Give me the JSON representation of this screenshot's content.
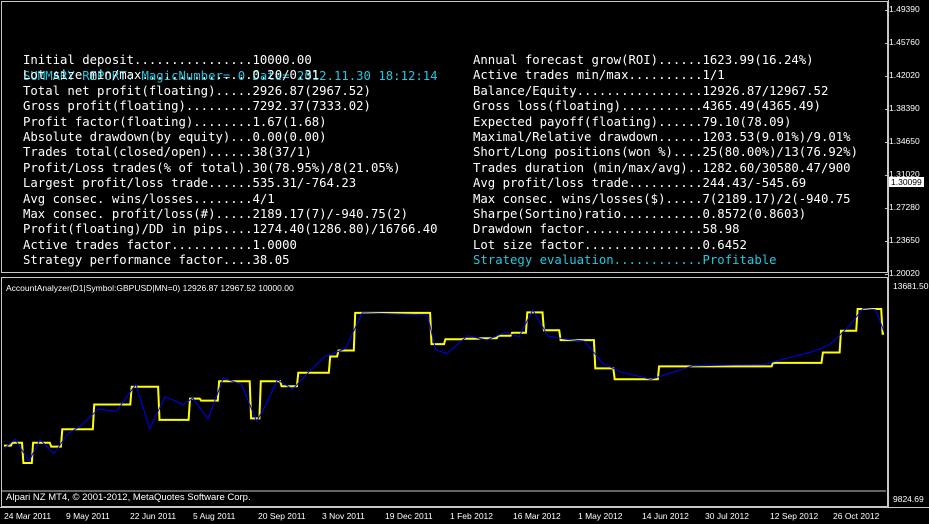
{
  "report": {
    "title": "SUMMARY REPORT: MagicNumber= 0 Date= 2012.11.30 18:12:14",
    "left": [
      "Initial deposit................10000.00",
      "Lot size min/max...............0.20/0.31",
      "Total net profit(floating).....2926.87(2967.52)",
      "Gross profit(floating).........7292.37(7333.02)",
      "Profit factor(floating)........1.67(1.68)",
      "Absolute drawdown(by equity)...0.00(0.00)",
      "Trades total(closed/open)......38(37/1)",
      "Profit/Loss trades(% of total).30(78.95%)/8(21.05%)",
      "Largest profit/loss trade......535.31/-764.23",
      "Avg consec. wins/losses........4/1",
      "Max consec. profit/loss(#).....2189.17(7)/-940.75(2)",
      "Profit(floating)/DD in pips....1274.40(1286.80)/16766.40",
      "Active trades factor...........1.0000",
      "Strategy performance factor....38.05"
    ],
    "right": [
      "Annual forecast grow(ROI)......1623.99(16.24%)",
      "Active trades min/max..........1/1",
      "Balance/Equity.................12926.87/12967.52",
      "Gross loss(floating)...........4365.49(4365.49)",
      "Expected payoff(floating)......79.10(78.09)",
      "Maximal/Relative drawdown......1203.53(9.01%)/9.01%",
      "Short/Long positions(won %)....25(80.00%)/13(76.92%)",
      "Trades duration (min/max/avg)..1282.60/30580.47/900",
      "Avg profit/loss trade..........244.43/-545.69",
      "Max consec. wins/losses($).....7(2189.17)/2(-940.75",
      "Sharpe(Sortino)ratio...........0.8572(0.8603)",
      "Drawdown factor................58.98",
      "Lot size factor................0.6452",
      "Strategy evaluation............Profitable"
    ]
  },
  "price_scale": [
    "1.49390",
    "1.45760",
    "1.42020",
    "1.38390",
    "1.34650",
    "1.31020",
    "1.27280",
    "1.23650",
    "1.20020"
  ],
  "current_price": "1.30099",
  "indicator_label": "AccountAnalyzer(D1|Symbol:GBPUSD|MN=0) 12926.87 12967.52 10000.00",
  "indicator_scale": {
    "max": "13681.50",
    "min": "9824.69"
  },
  "copyright": "Alpari NZ MT4, © 2001-2012, MetaQuotes Software Corp.",
  "dates": [
    "24 Mar 2011",
    "9 May 2011",
    "22 Jun 2011",
    "5 Aug 2011",
    "20 Sep 2011",
    "3 Nov 2011",
    "19 Dec 2011",
    "1 Feb 2012",
    "16 Mar 2012",
    "1 May 2012",
    "14 Jun 2012",
    "30 Jul 2012",
    "12 Sep 2012",
    "26 Oct 2012"
  ],
  "colors": {
    "balance": "#ffff00",
    "equity": "#0000ff",
    "title": "#22c8e0",
    "background": "#000000"
  },
  "chart_data": {
    "type": "line",
    "title": "",
    "ylim": [
      9824.69,
      13681.5
    ],
    "series": [
      {
        "name": "",
        "color": "#ffff00",
        "x": [
          "2011-03-07",
          "2011-03-12",
          "2011-03-13",
          "2011-03-20",
          "2011-03-21",
          "2011-03-27",
          "2011-03-28",
          "2011-04-09",
          "2011-04-10",
          "2011-04-17",
          "2011-04-18",
          "2011-05-10",
          "2011-05-11",
          "2011-06-06",
          "2011-06-07",
          "2011-06-26",
          "2011-06-27",
          "2011-07-18",
          "2011-07-19",
          "2011-07-26",
          "2011-07-27",
          "2011-08-08",
          "2011-08-09",
          "2011-08-31",
          "2011-09-01",
          "2011-09-07",
          "2011-09-08",
          "2011-09-22",
          "2011-09-23",
          "2011-10-04",
          "2011-10-05",
          "2011-10-27",
          "2011-10-28",
          "2011-11-02",
          "2011-11-03",
          "2011-11-14",
          "2011-11-15",
          "2012-01-08",
          "2012-01-09",
          "2012-01-18",
          "2012-01-19",
          "2012-01-31",
          "2012-02-01",
          "2012-02-12",
          "2012-02-13",
          "2012-02-25",
          "2012-02-26",
          "2012-03-06",
          "2012-03-07",
          "2012-03-17",
          "2012-03-18",
          "2012-03-29",
          "2012-03-30",
          "2012-04-10",
          "2012-04-11",
          "2012-05-05",
          "2012-05-06",
          "2012-05-19",
          "2012-05-20",
          "2012-06-20",
          "2012-06-21",
          "2012-09-10",
          "2012-09-11",
          "2012-10-16",
          "2012-10-17",
          "2012-10-29",
          "2012-10-30",
          "2012-11-10",
          "2012-11-11",
          "2012-11-28",
          "2012-11-29",
          "2012-11-30"
        ],
        "values": [
          10660,
          10660,
          10720,
          10720,
          10310,
          10310,
          10720,
          10720,
          10640,
          10640,
          10990,
          10990,
          11490,
          11490,
          11850,
          11850,
          11180,
          11180,
          11610,
          11610,
          11570,
          11570,
          11960,
          11960,
          11210,
          11210,
          11960,
          11960,
          11860,
          11860,
          12130,
          12130,
          12460,
          12460,
          12580,
          12580,
          13340,
          13340,
          12710,
          12710,
          12810,
          12810,
          12820,
          12820,
          12830,
          12830,
          12880,
          12880,
          12940,
          12940,
          13350,
          13350,
          12990,
          12990,
          12790,
          12790,
          12220,
          12220,
          12000,
          12000,
          12260,
          12260,
          12330,
          12330,
          12540,
          12540,
          12980,
          12980,
          13420,
          13420,
          12920,
          12920
        ]
      },
      {
        "name": "",
        "color": "#0000ff",
        "x": [
          "2011-03-07",
          "2011-03-15",
          "2011-03-25",
          "2011-04-02",
          "2011-04-12",
          "2011-04-22",
          "2011-05-01",
          "2011-05-14",
          "2011-05-27",
          "2011-06-10",
          "2011-06-20",
          "2011-07-01",
          "2011-07-14",
          "2011-07-21",
          "2011-08-01",
          "2011-08-12",
          "2011-08-25",
          "2011-09-05",
          "2011-09-12",
          "2011-09-20",
          "2011-10-01",
          "2011-10-12",
          "2011-10-24",
          "2011-11-01",
          "2011-11-08",
          "2011-11-20",
          "2012-01-06",
          "2012-01-12",
          "2012-01-20",
          "2012-02-04",
          "2012-02-18",
          "2012-03-02",
          "2012-03-12",
          "2012-03-22",
          "2012-04-02",
          "2012-04-15",
          "2012-04-28",
          "2012-05-12",
          "2012-05-24",
          "2012-06-15",
          "2012-07-15",
          "2012-09-05",
          "2012-09-20",
          "2012-10-10",
          "2012-10-22",
          "2012-11-04",
          "2012-11-15",
          "2012-11-24",
          "2012-11-30"
        ],
        "values": [
          10600,
          10790,
          10350,
          10780,
          10500,
          10900,
          11050,
          11400,
          11350,
          11900,
          11000,
          11650,
          11490,
          11620,
          11200,
          12020,
          11900,
          11150,
          11500,
          11990,
          11800,
          12130,
          12460,
          12540,
          12620,
          13340,
          13300,
          12600,
          12520,
          12880,
          12790,
          12950,
          12860,
          13400,
          12870,
          12810,
          12770,
          12310,
          12150,
          12000,
          12270,
          12300,
          12420,
          12560,
          12700,
          13050,
          13430,
          13400,
          12967.52
        ]
      }
    ]
  }
}
